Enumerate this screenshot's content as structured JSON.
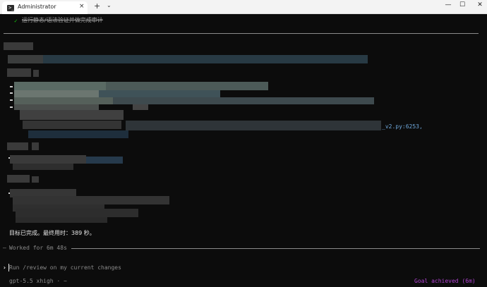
{
  "window": {
    "tab_title": "Administrator",
    "tab_icon": "terminal-icon",
    "close_tab_glyph": "×",
    "new_tab_glyph": "+",
    "dropdown_glyph": "⌄",
    "minimize_glyph": "—",
    "maximize_glyph": "☐",
    "close_glyph": "✕"
  },
  "terminal": {
    "check_glyph": "✓",
    "task_done_text": "运行静态/语法验证并做完成审计",
    "file_ref": "_v2.py:6253,",
    "goal_summary": "目标已完成。最终用时：389 秒。",
    "worked_dash": "—",
    "worked_text": "Worked for 6m 48s",
    "prompt_glyph": "›",
    "input_placeholder": "Run /review on my current changes",
    "model_status": "gpt-5.5 xhigh · ~",
    "goal_status": "Goal achieved (6m)"
  },
  "colors": {
    "background": "#0c0c0c",
    "check": "#16c60c",
    "file_link": "#6fa8dc",
    "goal_status": "#b043d1",
    "muted": "#8a8a8a"
  }
}
